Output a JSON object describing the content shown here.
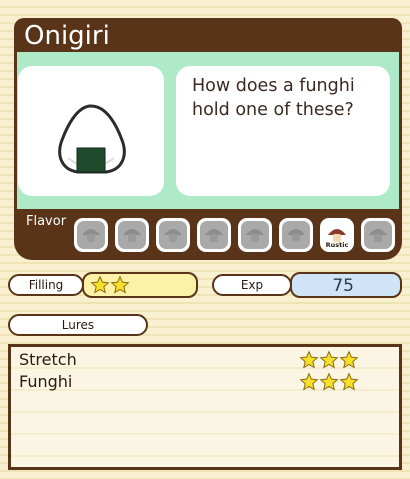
{
  "item": {
    "name": "Onigiri",
    "description": "How does a funghi hold one of these?"
  },
  "flavor": {
    "label": "Flavor",
    "icons": [
      {
        "name": "",
        "active": false
      },
      {
        "name": "",
        "active": false
      },
      {
        "name": "",
        "active": false
      },
      {
        "name": "",
        "active": false
      },
      {
        "name": "",
        "active": false
      },
      {
        "name": "",
        "active": false
      },
      {
        "name": "Rustic",
        "active": true
      },
      {
        "name": "",
        "active": false
      }
    ]
  },
  "filling": {
    "label": "Filling",
    "stars": 2
  },
  "exp": {
    "label": "Exp",
    "value": "75"
  },
  "lures": {
    "label": "Lures",
    "rows": [
      {
        "name": "Stretch",
        "stars": 3
      },
      {
        "name": "Funghi",
        "stars": 3
      }
    ]
  },
  "colors": {
    "brown": "#5a3418",
    "green_panel": "#aeeac8",
    "star_yellow": "#f7e02a",
    "exp_blue": "#cfe4f7",
    "filling_yellow": "#fbf2a8"
  }
}
